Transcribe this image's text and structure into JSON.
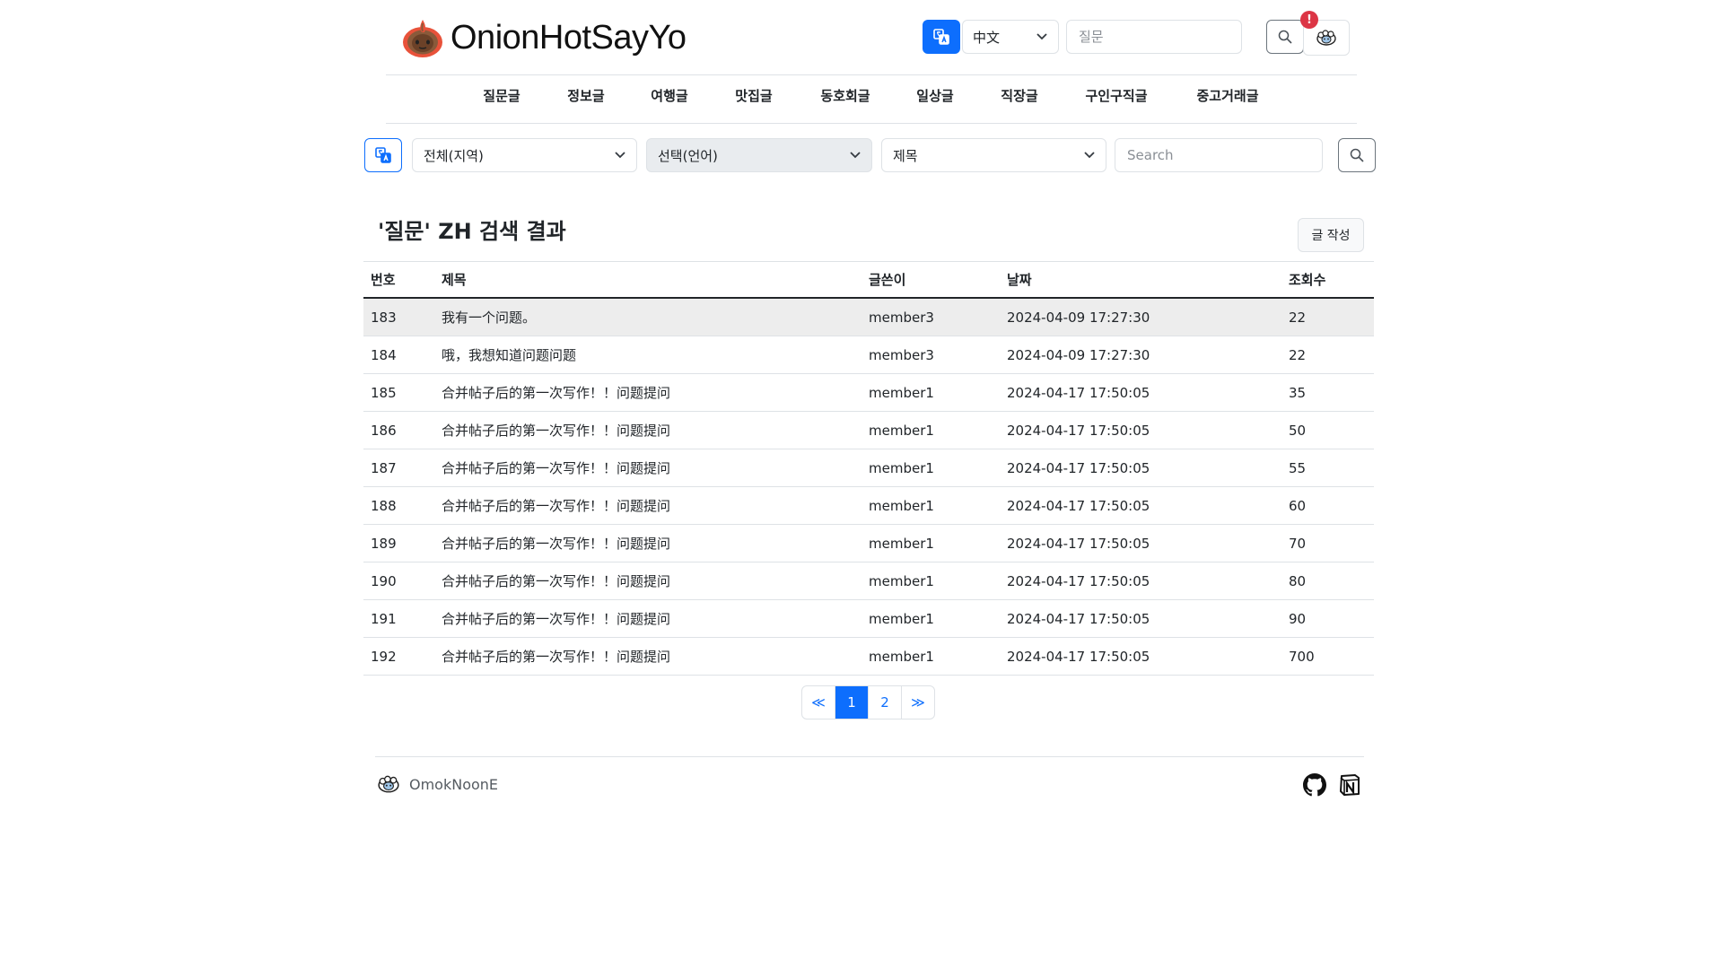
{
  "brand": {
    "name": "OnionHotSayYo"
  },
  "header": {
    "language": "中文",
    "search_placeholder": "질문",
    "notification_count": "!"
  },
  "nav": {
    "items": [
      "질문글",
      "정보글",
      "여행글",
      "맛집글",
      "동호회글",
      "일상글",
      "직장글",
      "구인구직글",
      "중고거래글"
    ]
  },
  "filters": {
    "region": "전체(지역)",
    "language": "선택(언어)",
    "field": "제목",
    "search_placeholder": "Search"
  },
  "results": {
    "title": "'질문' ZH 검색 결과",
    "write_button": "글 작성",
    "columns": [
      "번호",
      "제목",
      "글쓴이",
      "날짜",
      "조회수"
    ],
    "rows": [
      {
        "no": "183",
        "title": "我有一个问题。",
        "writer": "member3",
        "date": "2024-04-09 17:27:30",
        "views": "22"
      },
      {
        "no": "184",
        "title": "哦，我想知道问题问题",
        "writer": "member3",
        "date": "2024-04-09 17:27:30",
        "views": "22"
      },
      {
        "no": "185",
        "title": "合并帖子后的第一次写作！！问题提问",
        "writer": "member1",
        "date": "2024-04-17 17:50:05",
        "views": "35"
      },
      {
        "no": "186",
        "title": "合并帖子后的第一次写作！！问题提问",
        "writer": "member1",
        "date": "2024-04-17 17:50:05",
        "views": "50"
      },
      {
        "no": "187",
        "title": "合并帖子后的第一次写作！！问题提问",
        "writer": "member1",
        "date": "2024-04-17 17:50:05",
        "views": "55"
      },
      {
        "no": "188",
        "title": "合并帖子后的第一次写作！！问题提问",
        "writer": "member1",
        "date": "2024-04-17 17:50:05",
        "views": "60"
      },
      {
        "no": "189",
        "title": "合并帖子后的第一次写作！！问题提问",
        "writer": "member1",
        "date": "2024-04-17 17:50:05",
        "views": "70"
      },
      {
        "no": "190",
        "title": "合并帖子后的第一次写作！！问题提问",
        "writer": "member1",
        "date": "2024-04-17 17:50:05",
        "views": "80"
      },
      {
        "no": "191",
        "title": "合并帖子后的第一次写作！！问题提问",
        "writer": "member1",
        "date": "2024-04-17 17:50:05",
        "views": "90"
      },
      {
        "no": "192",
        "title": "合并帖子后的第一次写作！！问题提问",
        "writer": "member1",
        "date": "2024-04-17 17:50:05",
        "views": "700"
      }
    ]
  },
  "pagination": {
    "prev": "≪",
    "pages": [
      "1",
      "2"
    ],
    "current": "1",
    "next": "≫"
  },
  "footer": {
    "name": "OmokNoonE"
  },
  "icons": {
    "translate": "translate-icon",
    "search": "search-icon",
    "profile": "sheep-avatar-icon",
    "github": "github-icon",
    "notion": "notion-icon",
    "logo": "onion-logo-icon"
  },
  "colors": {
    "primary": "#0d6efd",
    "badge": "#dc3545",
    "highlight_row": "#ededed"
  }
}
